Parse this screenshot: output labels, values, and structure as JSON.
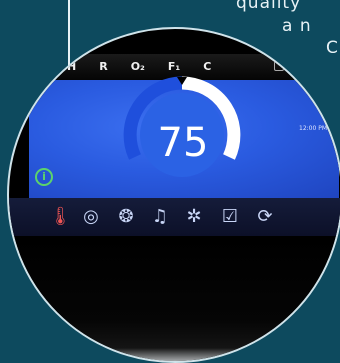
{
  "background": {
    "text_lines": [
      "quality",
      "a n",
      "C"
    ],
    "color": "#0d4a5e"
  },
  "device": {
    "mode_letters": [
      "H",
      "R",
      "O₂",
      "F₁",
      "C"
    ],
    "time": "12:00 PM",
    "temperature": "75",
    "info_label": "i",
    "icons": [
      "thermometer-icon",
      "jets-icon",
      "pump-icon",
      "music-icon",
      "light-icon",
      "checklist-icon",
      "sync-icon"
    ],
    "colors": {
      "screen": "#2a5be0",
      "arc_active": "#1f4fdc",
      "arc_inactive": "#ffffff",
      "info": "#5cd36c"
    }
  }
}
